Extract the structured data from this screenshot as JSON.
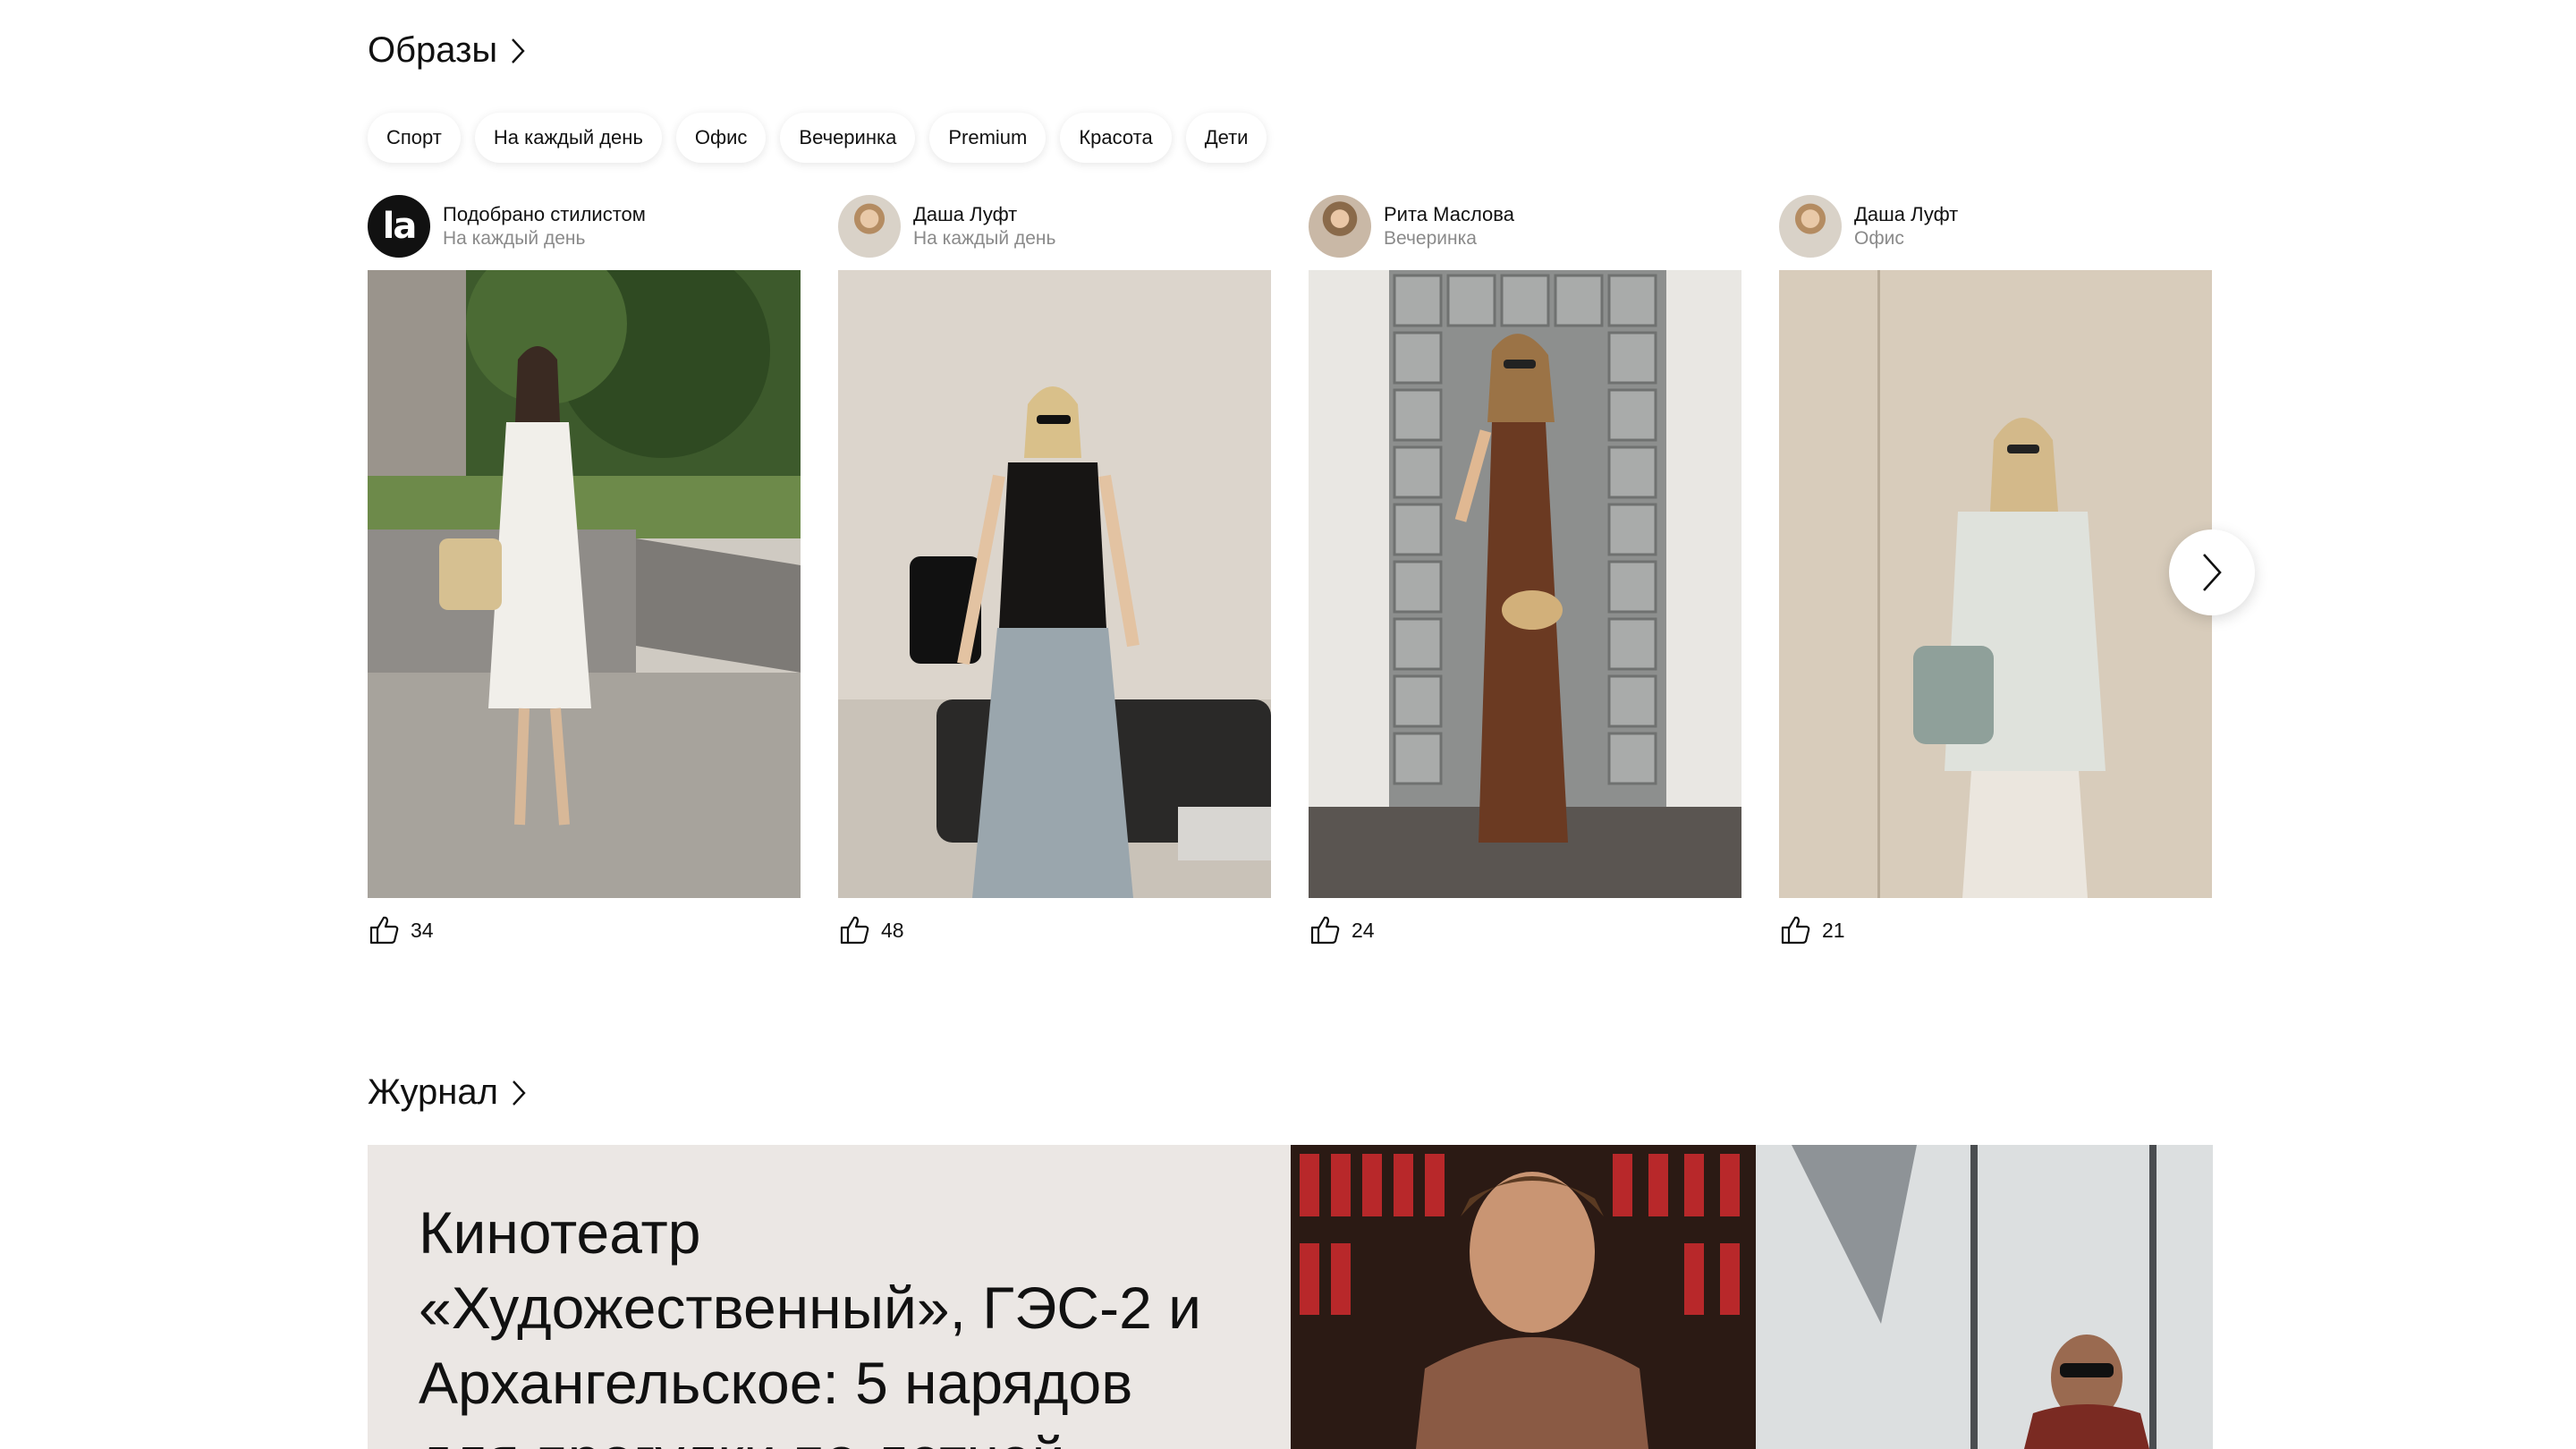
{
  "looks": {
    "title": "Образы",
    "chips": [
      "Спорт",
      "На каждый день",
      "Офис",
      "Вечеринка",
      "Premium",
      "Красота",
      "Дети"
    ],
    "cards": [
      {
        "author": "Подобрано стилистом",
        "category": "На каждый день",
        "likes": "34",
        "avatar_text": "la"
      },
      {
        "author": "Даша Луфт",
        "category": "На каждый день",
        "likes": "48"
      },
      {
        "author": "Рита Маслова",
        "category": "Вечеринка",
        "likes": "24"
      },
      {
        "author": "Даша Луфт",
        "category": "Офис",
        "likes": "21"
      }
    ],
    "icons": {
      "like": "thumbs-up-icon",
      "next": "chevron-right-icon",
      "title_chevron": "chevron-right-icon"
    }
  },
  "journal": {
    "title": "Журнал",
    "article_title": "Кинотеатр «Художественный», ГЭС-2 и Архангельское: 5 нарядов для прогулки по летней"
  }
}
